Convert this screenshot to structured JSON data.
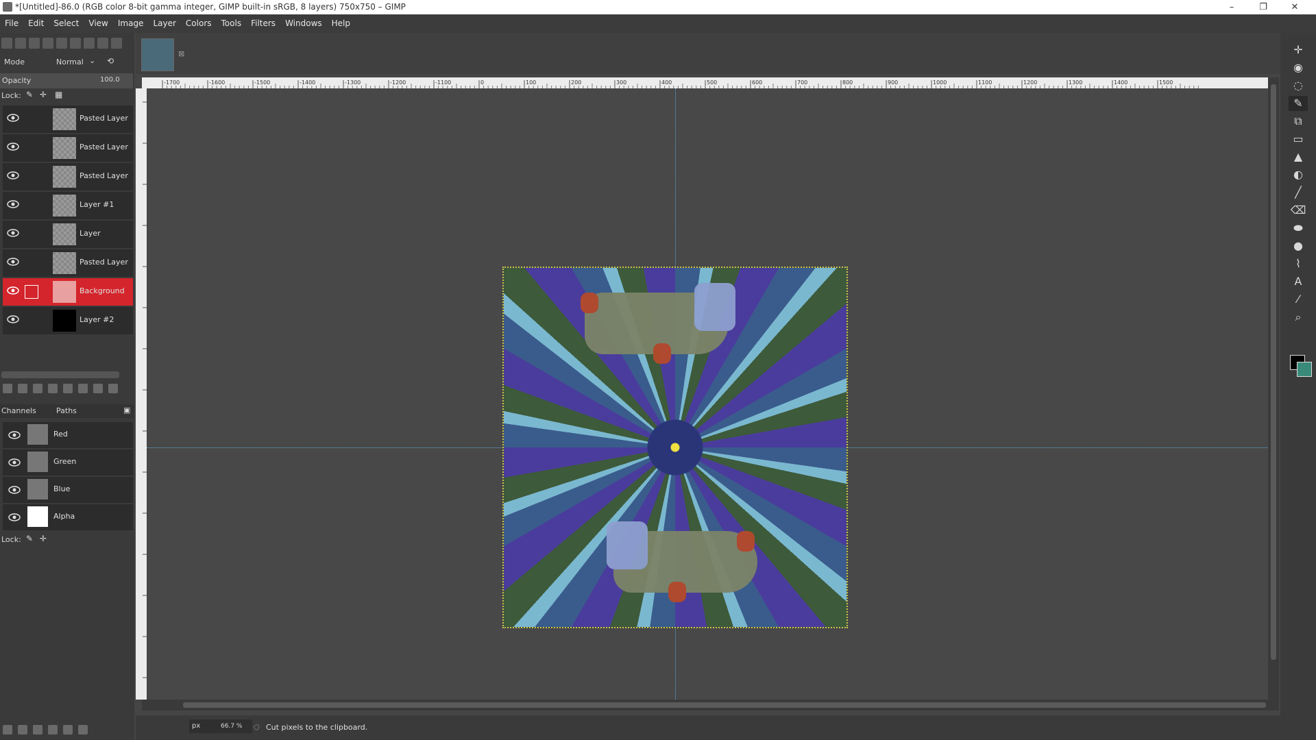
{
  "window": {
    "title": "*[Untitled]-86.0 (RGB color 8-bit gamma integer, GIMP built-in sRGB, 8 layers) 750x750 – GIMP",
    "minimize": "–",
    "restore": "❐",
    "close": "✕"
  },
  "menu": [
    "File",
    "Edit",
    "Select",
    "View",
    "Image",
    "Layer",
    "Colors",
    "Tools",
    "Filters",
    "Windows",
    "Help"
  ],
  "layers_panel": {
    "mode_label": "Mode",
    "mode_value": "Normal",
    "opacity_label": "Opacity",
    "opacity_value": "100.0",
    "lock_label": "Lock:",
    "layers": [
      {
        "name": "Pasted Layer"
      },
      {
        "name": "Pasted Layer"
      },
      {
        "name": "Pasted Layer"
      },
      {
        "name": "Layer #1"
      },
      {
        "name": "Layer"
      },
      {
        "name": "Pasted Layer"
      },
      {
        "name": "Background",
        "selected": true
      },
      {
        "name": "Layer #2"
      }
    ]
  },
  "channels_panel": {
    "tab_channels": "Channels",
    "tab_paths": "Paths",
    "channels": [
      "Red",
      "Green",
      "Blue",
      "Alpha"
    ],
    "lock_label": "Lock:"
  },
  "ruler_ticks": [
    "-1700",
    "-1600",
    "-1500",
    "-1400",
    "-1300",
    "-1200",
    "-1100",
    "0",
    "100",
    "200",
    "300",
    "400",
    "500",
    "600",
    "700",
    "800",
    "900",
    "1000",
    "1100",
    "1200",
    "1300",
    "1400",
    "1500"
  ],
  "statusbar": {
    "unit": "px",
    "zoom": "66.7 %",
    "message": "Cut pixels to the clipboard."
  },
  "colors": {
    "selected_layer": "#d4252c",
    "foreground": "#000000",
    "background": "#3a8a7a",
    "guide": "#5fa8d8"
  },
  "tools": [
    "move-icon",
    "fuzzy-select-icon",
    "lasso-icon",
    "paths-icon",
    "crop-icon",
    "transform-icon",
    "bucket-fill-icon",
    "blur-icon",
    "paintbrush-icon",
    "eraser-icon",
    "clone-icon",
    "dodge-icon",
    "path-tool-icon",
    "text-icon",
    "color-picker-icon",
    "zoom-icon"
  ]
}
